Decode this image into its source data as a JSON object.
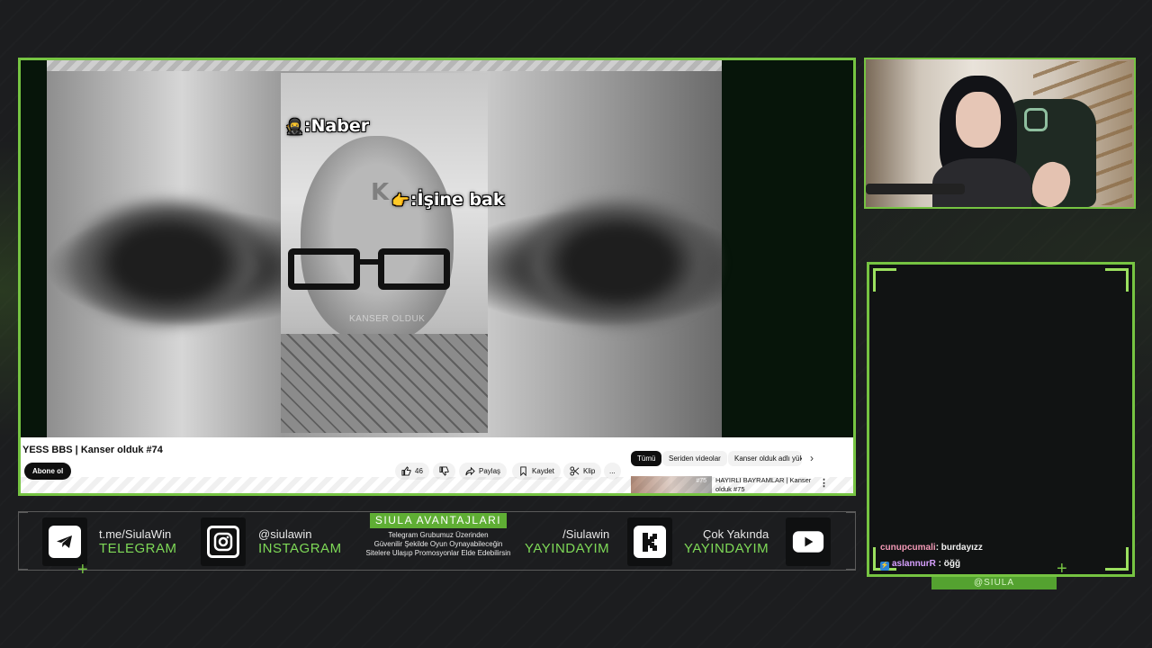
{
  "video": {
    "overlay_1": ":Naber",
    "overlay_1_icon": "ninja-emoji",
    "overlay_2": ":İşine bak",
    "overlay_2_icon": "pointing-hand-emoji",
    "watermark": "K",
    "caption_watermark": "KANSER OLDUK"
  },
  "youtube": {
    "title": "YESS BBS | Kanser olduk #74",
    "subscribe_label": "Abone ol",
    "like_count": "46",
    "share_label": "Paylaş",
    "save_label": "Kaydet",
    "clip_label": "Klip",
    "more_label": "...",
    "chips": [
      "Tümü",
      "Seriden videolar",
      "Kanser olduk adlı yük"
    ],
    "related_title": "HAYIRLI BAYRAMLAR | Kanser olduk #75",
    "related_badge": "#75"
  },
  "chat": {
    "messages": [
      {
        "user": "cunupcumali",
        "text": ": burdayızz",
        "color": "#f49ab7"
      },
      {
        "user": "aslannurR",
        "text": " : öğğ",
        "color": "#d7a0ff",
        "badge": "⚡"
      }
    ],
    "tag": "@SIULA"
  },
  "socials": [
    {
      "icon": "telegram-icon",
      "line1": "t.me/SiulaWin",
      "line2": "TELEGRAM"
    },
    {
      "icon": "instagram-icon",
      "line1": "@siulawin",
      "line2": "INSTAGRAM"
    },
    {
      "icon": "kick-icon",
      "line1": "/Siulawin",
      "line2": "YAYINDAYIM"
    },
    {
      "icon": "youtube-icon",
      "line1": "Çok Yakında",
      "line2": "YAYINDAYIM"
    }
  ],
  "promo": {
    "title": "SIULA AVANTAJLARI",
    "line1": "Telegram Grubumuz Üzerinden",
    "line2": "Güvenilir Şekilde Oyun Oynayabileceğin",
    "line3": "Sitelere Ulaşıp Promosyonlar Elde Edebilirsin"
  },
  "colors": {
    "accent": "#76c442",
    "background": "#1c1d1f"
  }
}
